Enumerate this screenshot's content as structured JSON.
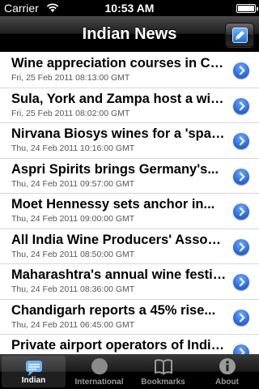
{
  "status_bar": {
    "carrier": "Carrier",
    "time": "10:53 AM"
  },
  "nav": {
    "title": "Indian News"
  },
  "news_items": [
    {
      "title": "Wine appreciation courses in Ch...",
      "date": "Fri, 25 Feb 2011 08:13:00 GMT"
    },
    {
      "title": "Sula, York and Zampa host a win...",
      "date": "Fri, 25 Feb 2011 08:02:00 GMT"
    },
    {
      "title": "Nirvana Biosys wines for a 'spar...",
      "date": "Thu, 24 Feb 2011 10:16:00 GMT"
    },
    {
      "title": "Aspri Spirits brings Germany's...",
      "date": "Thu, 24 Feb 2011 09:57:00 GMT"
    },
    {
      "title": "Moet Hennessy sets anchor in...",
      "date": "Thu, 24 Feb 2011 09:00:00 GMT"
    },
    {
      "title": "All India Wine Producers' Associ...",
      "date": "Thu, 24 Feb 2011 08:50:00 GMT"
    },
    {
      "title": "Maharashtra's annual wine festiv...",
      "date": "Thu, 24 Feb 2011 08:36:00 GMT"
    },
    {
      "title": "Chandigarh reports a 45% rise...",
      "date": "Thu, 24 Feb 2011 06:45:00 GMT"
    },
    {
      "title": "Private airport operators of India...",
      "date": ""
    }
  ],
  "tabs": [
    {
      "label": "Indian",
      "icon": "speech-bubble-icon",
      "selected": true
    },
    {
      "label": "International",
      "icon": "globe-icon",
      "selected": false
    },
    {
      "label": "Bookmarks",
      "icon": "book-icon",
      "selected": false
    },
    {
      "label": "About",
      "icon": "info-icon",
      "selected": false
    }
  ],
  "colors": {
    "accent_blue": "#2264d6",
    "nav_background": "#000000"
  }
}
